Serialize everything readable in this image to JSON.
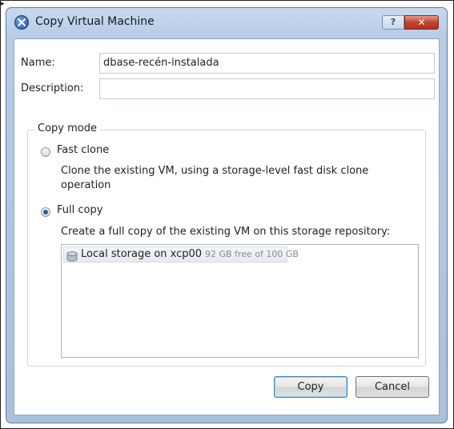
{
  "window": {
    "title": "Copy Virtual Machine",
    "help_label": "?",
    "close_label": "✕"
  },
  "form": {
    "name_label": "Name:",
    "name_value": "dbase-recén-instalada",
    "description_label": "Description:",
    "description_value": ""
  },
  "copy_mode": {
    "legend": "Copy mode",
    "fast_clone": {
      "label": "Fast clone",
      "selected": false,
      "description": "Clone the existing VM, using a storage-level fast disk clone operation"
    },
    "full_copy": {
      "label": "Full copy",
      "selected": true,
      "description": "Create a full copy of the existing VM on this storage repository:"
    }
  },
  "storage_list": {
    "items": [
      {
        "name": "Local storage on xcp00",
        "free": "92 GB free of 100 GB",
        "icon": "disk-icon"
      }
    ]
  },
  "buttons": {
    "copy_label": "Copy",
    "cancel_label": "Cancel"
  },
  "colors": {
    "title_bar": "#b6cce5",
    "close_button": "#c0432d",
    "radio_selected": "#2e5fa8"
  }
}
